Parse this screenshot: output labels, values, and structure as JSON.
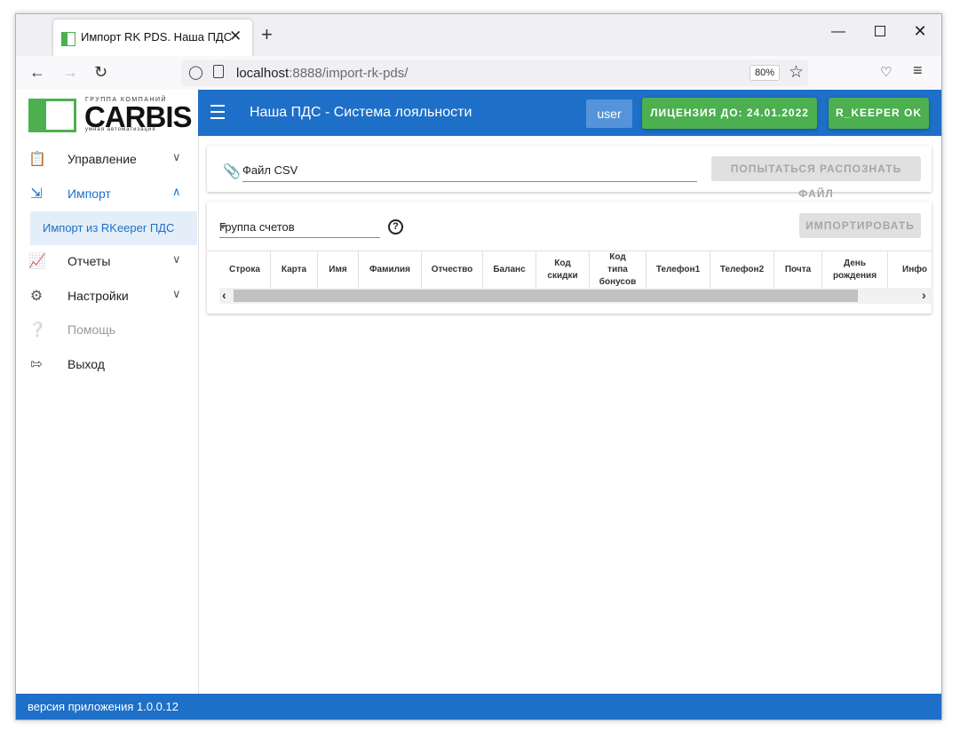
{
  "browser": {
    "tab_title": "Импорт RK PDS. Наша ПДС",
    "tab_close": "✕",
    "new_tab": "+",
    "url_host": "localhost",
    "url_rest": ":8888/import-rk-pds/",
    "zoom": "80%"
  },
  "logo": {
    "group_text": "ГРУППА КОМПАНИЙ",
    "brand": "CARBIS",
    "tagline": "умная автоматизация"
  },
  "sidebar": {
    "items": [
      {
        "label": "Управление",
        "icon": "clipboard-icon"
      },
      {
        "label": "Импорт",
        "icon": "login-icon"
      },
      {
        "label": "Импорт из RKeeper ПДС"
      },
      {
        "label": "Отчеты",
        "icon": "chart-icon"
      },
      {
        "label": "Настройки",
        "icon": "gear-icon"
      },
      {
        "label": "Помощь",
        "icon": "help-icon"
      },
      {
        "label": "Выход",
        "icon": "logout-icon"
      }
    ]
  },
  "topbar": {
    "title": "Наша ПДС - Система лояльности",
    "user": "user",
    "license": "ЛИЦЕНЗИЯ ДО: 24.01.2022",
    "rkeeper_status": "R_KEEPER OK"
  },
  "upload": {
    "field_label": "Файл CSV",
    "recognize_button": "ПОПЫТАТЬСЯ РАСПОЗНАТЬ ФАЙЛ"
  },
  "import": {
    "group_label": "Группа счетов",
    "help": "?",
    "import_button": "ИМПОРТИРОВАТЬ",
    "columns": [
      "Строка",
      "Карта",
      "Имя",
      "Фамилия",
      "Отчество",
      "Баланс",
      "Код скидки",
      "Код типа бонусов",
      "Телефон1",
      "Телефон2",
      "Почта",
      "День рождения",
      "Инфо"
    ]
  },
  "footer": {
    "version": "версия приложения 1.0.0.12"
  },
  "colors": {
    "primary": "#1e6fc8",
    "green": "#4caf50",
    "disabled": "#e0e0e0"
  }
}
